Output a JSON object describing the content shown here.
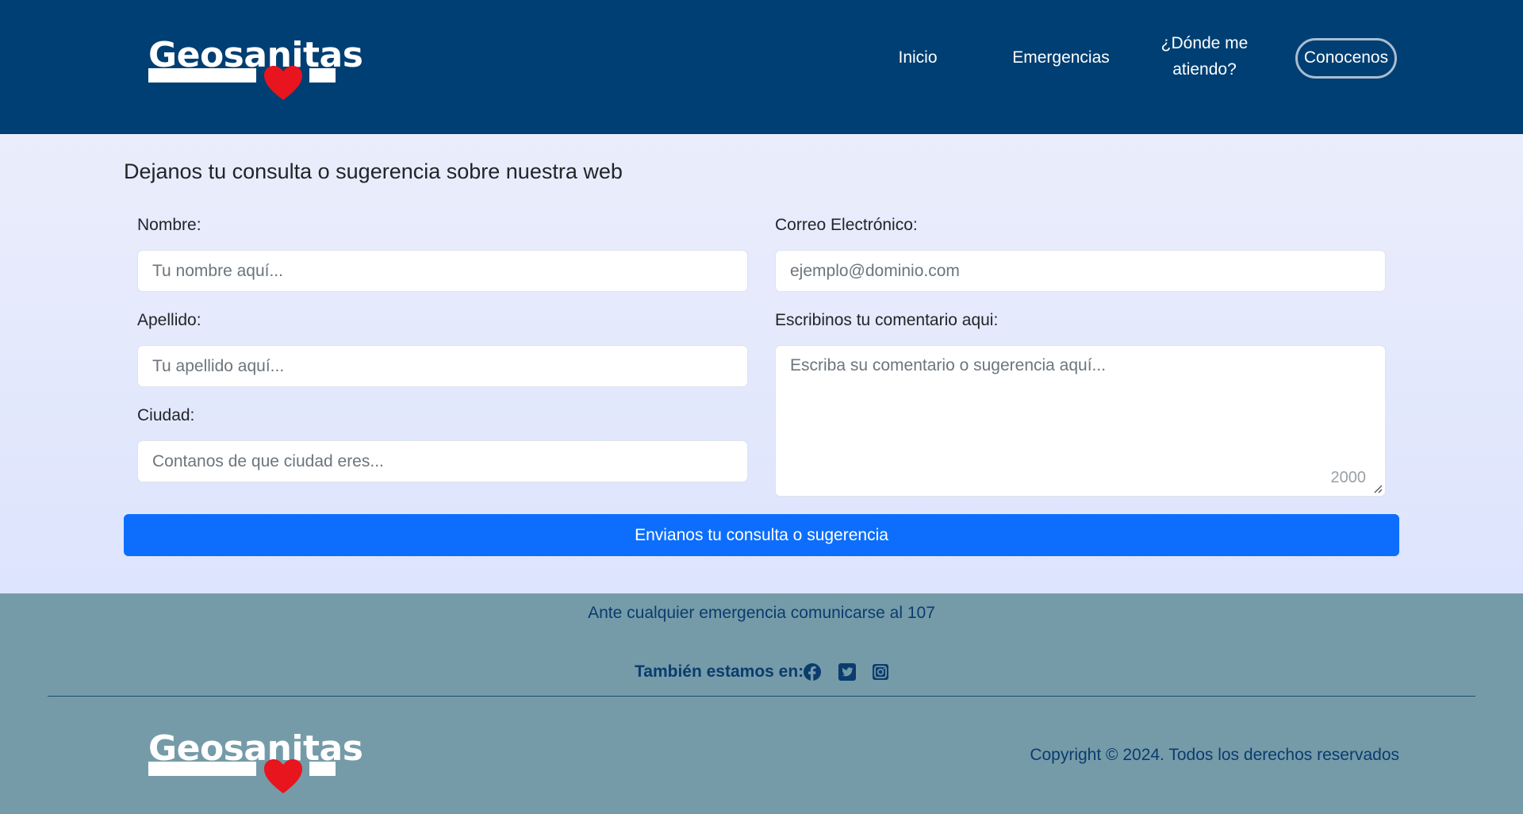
{
  "header": {
    "logo_text": "Geosanitas",
    "nav": {
      "inicio": "Inicio",
      "emergencias": "Emergencias",
      "donde_line1": "¿Dónde me",
      "donde_line2": "atiendo?",
      "conocenos": "Conocenos"
    }
  },
  "form": {
    "title": "Dejanos tu consulta o sugerencia sobre nuestra web",
    "nombre": {
      "label": "Nombre:",
      "placeholder": "Tu nombre aquí..."
    },
    "apellido": {
      "label": "Apellido:",
      "placeholder": "Tu apellido aquí..."
    },
    "ciudad": {
      "label": "Ciudad:",
      "placeholder": "Contanos de que ciudad eres..."
    },
    "correo": {
      "label": "Correo Electrónico:",
      "placeholder": "ejemplo@dominio.com"
    },
    "comentario": {
      "label": "Escribinos tu comentario aqui:",
      "placeholder": "Escriba su comentario o sugerencia aquí...",
      "counter": "2000"
    },
    "submit_label": "Envianos tu consulta o sugerencia"
  },
  "footer": {
    "emergency_text": "Ante cualquier emergencia comunicarse al 107",
    "social_label": "También estamos en:",
    "social_icons": [
      "facebook-icon",
      "twitter-icon",
      "instagram-icon"
    ],
    "logo_text": "Geosanitas",
    "copyright": "Copyright © 2024. Todos los derechos reservados"
  },
  "colors": {
    "header_bg": "#003f73",
    "main_bg": "#e4e9fc",
    "footer_bg": "#759ba9",
    "accent": "#0d6efd",
    "heart": "#e8141e",
    "footer_text": "#0a3c6d"
  }
}
